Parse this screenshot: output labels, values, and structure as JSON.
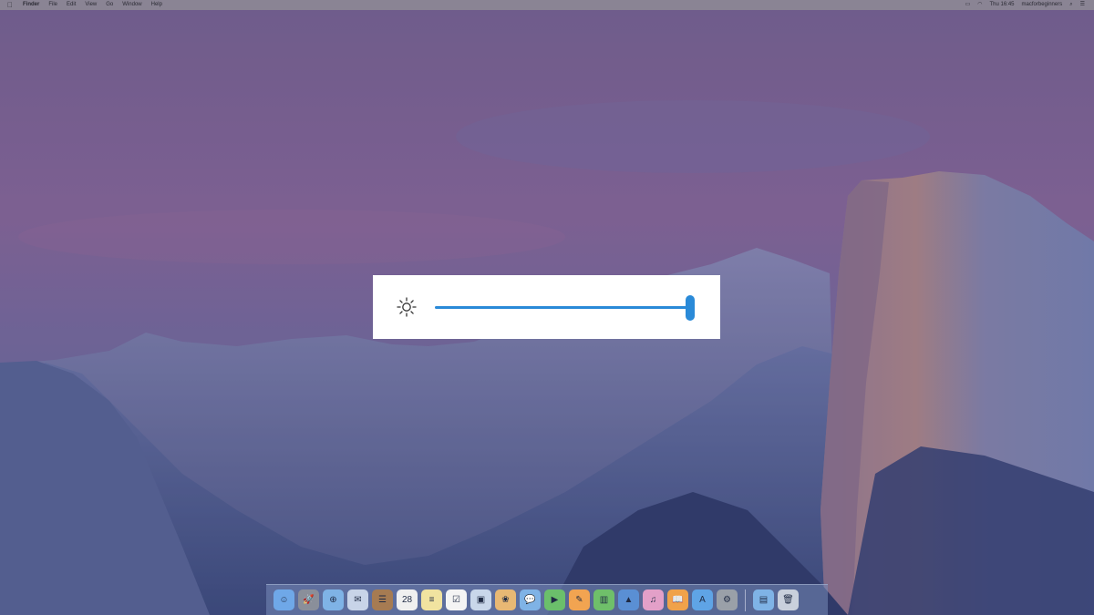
{
  "menubar": {
    "apple_icon": "apple-icon",
    "items": [
      "Finder",
      "File",
      "Edit",
      "View",
      "Go",
      "Window",
      "Help"
    ],
    "right": {
      "display_icon": "display-icon",
      "wifi_icon": "wifi-icon",
      "clock": "Thu 16:45",
      "user": "macforbeginners",
      "search_icon": "spotlight-search-icon",
      "notifications_icon": "notification-center-icon"
    }
  },
  "brightness_hud": {
    "icon": "brightness-sun-icon",
    "level_percent": 100,
    "accent_color": "#2a8ad8"
  },
  "dock": {
    "apps": [
      {
        "name": "finder",
        "glyph": "☺",
        "bg": "#6fa8e8"
      },
      {
        "name": "launchpad",
        "glyph": "🚀",
        "bg": "#8a8f9a"
      },
      {
        "name": "safari",
        "glyph": "⊕",
        "bg": "#7fb3e6"
      },
      {
        "name": "mail",
        "glyph": "✉",
        "bg": "#c8d4e8"
      },
      {
        "name": "contacts",
        "glyph": "☰",
        "bg": "#a67b52"
      },
      {
        "name": "calendar",
        "glyph": "28",
        "bg": "#f0f0f0"
      },
      {
        "name": "notes",
        "glyph": "≡",
        "bg": "#f1e3a0"
      },
      {
        "name": "reminders",
        "glyph": "☑",
        "bg": "#f4f4f4"
      },
      {
        "name": "preview",
        "glyph": "▣",
        "bg": "#c9d7ea"
      },
      {
        "name": "photos",
        "glyph": "❀",
        "bg": "#e8b874"
      },
      {
        "name": "messages",
        "glyph": "💬",
        "bg": "#7fb3e6"
      },
      {
        "name": "facetime",
        "glyph": "▶",
        "bg": "#6bbf6b"
      },
      {
        "name": "pages",
        "glyph": "✎",
        "bg": "#f2a451"
      },
      {
        "name": "numbers",
        "glyph": "▥",
        "bg": "#6fbf6a"
      },
      {
        "name": "keynote",
        "glyph": "▲",
        "bg": "#5a8fd4"
      },
      {
        "name": "itunes",
        "glyph": "♫",
        "bg": "#e3a0c8"
      },
      {
        "name": "ibooks",
        "glyph": "📖",
        "bg": "#f0a24a"
      },
      {
        "name": "app-store",
        "glyph": "A",
        "bg": "#5fa4e6"
      },
      {
        "name": "system-preferences",
        "glyph": "⚙",
        "bg": "#9aa0a8"
      }
    ],
    "stack": {
      "name": "downloads-folder",
      "glyph": "▤",
      "bg": "#7fb3e6"
    },
    "trash": {
      "name": "trash",
      "glyph": "🗑",
      "bg": "#c9d0dc"
    }
  }
}
